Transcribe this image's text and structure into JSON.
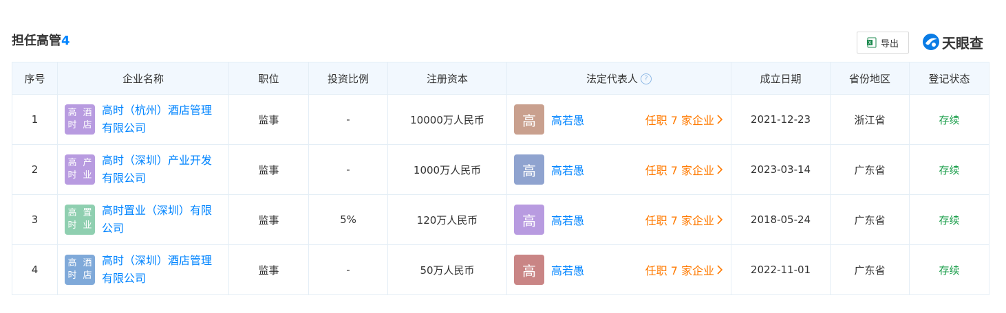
{
  "header": {
    "title": "担任高管",
    "count": "4",
    "export_label": "导出",
    "brand": "天眼查"
  },
  "table": {
    "columns": [
      "序号",
      "企业名称",
      "职位",
      "投资比例",
      "注册资本",
      "法定代表人",
      "成立日期",
      "省份地区",
      "登记状态"
    ],
    "rows": [
      {
        "index": "1",
        "logo_text": "高时酒店",
        "logo_color": "#b89be0",
        "company": "高时（杭州）酒店管理有限公司",
        "position": "监事",
        "ratio": "-",
        "capital": "10000万人民币",
        "rep_avatar": "高",
        "rep_avatar_color": "#c9a08e",
        "rep_name": "高若愚",
        "rep_link": "任职 7 家企业",
        "date": "2021-12-23",
        "region": "浙江省",
        "status": "存续"
      },
      {
        "index": "2",
        "logo_text": "高时产业",
        "logo_color": "#b89be0",
        "company": "高时（深圳）产业开发有限公司",
        "position": "监事",
        "ratio": "-",
        "capital": "1000万人民币",
        "rep_avatar": "高",
        "rep_avatar_color": "#8fa3cf",
        "rep_name": "高若愚",
        "rep_link": "任职 7 家企业",
        "date": "2023-03-14",
        "region": "广东省",
        "status": "存续"
      },
      {
        "index": "3",
        "logo_text": "高时置业",
        "logo_color": "#8fcfb0",
        "company": "高时置业（深圳）有限公司",
        "position": "监事",
        "ratio": "5%",
        "capital": "120万人民币",
        "rep_avatar": "高",
        "rep_avatar_color": "#b89be0",
        "rep_name": "高若愚",
        "rep_link": "任职 7 家企业",
        "date": "2018-05-24",
        "region": "广东省",
        "status": "存续"
      },
      {
        "index": "4",
        "logo_text": "高时酒店",
        "logo_color": "#7fa9d9",
        "company": "高时（深圳）酒店管理有限公司",
        "position": "监事",
        "ratio": "-",
        "capital": "50万人民币",
        "rep_avatar": "高",
        "rep_avatar_color": "#c98585",
        "rep_name": "高若愚",
        "rep_link": "任职 7 家企业",
        "date": "2022-11-01",
        "region": "广东省",
        "status": "存续"
      }
    ]
  },
  "icons": {
    "export": "excel-icon",
    "brand_logo": "tianyancha-logo-icon",
    "help": "question-icon",
    "arrow": "chevron-right-icon"
  }
}
